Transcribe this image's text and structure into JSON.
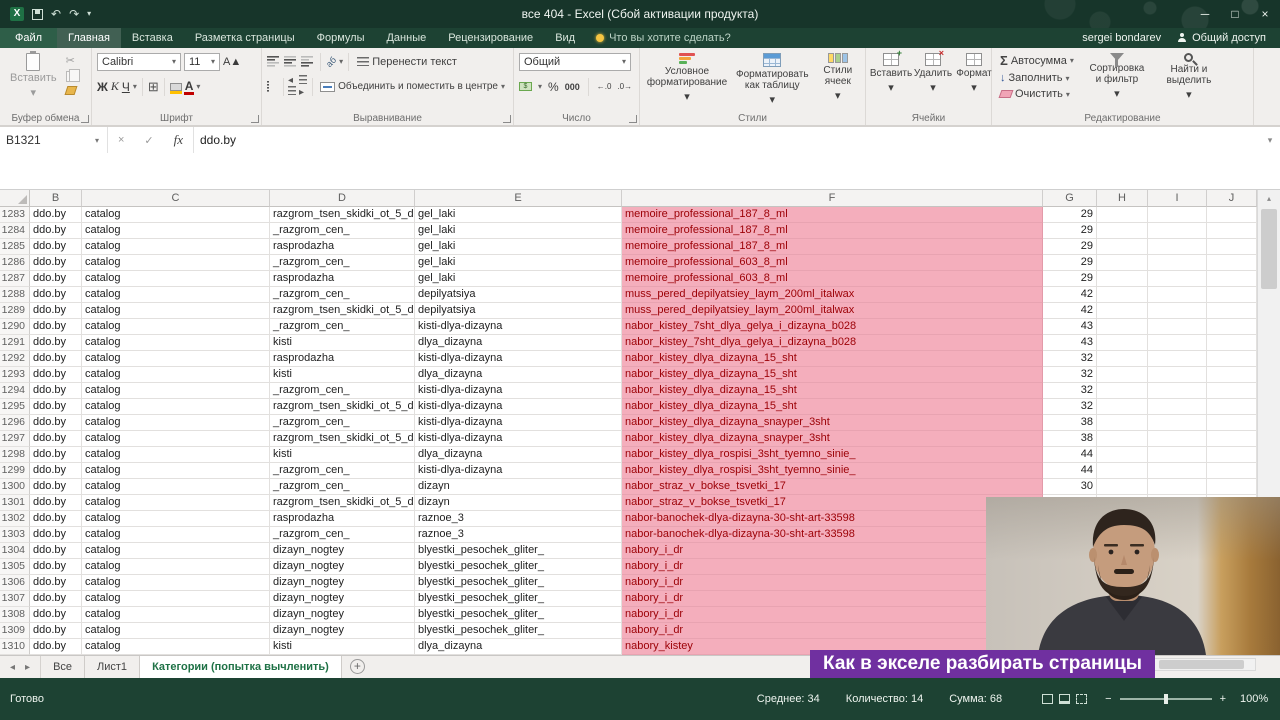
{
  "titlebar": {
    "title": "все 404  -  Excel (Сбой активации продукта)",
    "window_min": "─",
    "window_max": "□",
    "window_close": "×"
  },
  "account": {
    "user": "sergei bondarev",
    "share": "Общий доступ"
  },
  "ribbon_tabs": [
    {
      "label": "Файл",
      "type": "file"
    },
    {
      "label": "Главная",
      "active": true
    },
    {
      "label": "Вставка"
    },
    {
      "label": "Разметка страницы"
    },
    {
      "label": "Формулы"
    },
    {
      "label": "Данные"
    },
    {
      "label": "Рецензирование"
    },
    {
      "label": "Вид"
    }
  ],
  "tellme": "Что вы хотите сделать?",
  "ribbon": {
    "clipboard": {
      "paste": "Вставить",
      "label": "Буфер обмена"
    },
    "font": {
      "family": "Calibri",
      "size": "11",
      "bold": "Ж",
      "italic": "К",
      "underline": "Ч",
      "label": "Шрифт"
    },
    "alignment": {
      "wrap": "Перенести текст",
      "merge": "Объединить и поместить в центре",
      "label": "Выравнивание"
    },
    "number": {
      "format": "Общий",
      "thousands": "000",
      "percent": "%",
      "label": "Число"
    },
    "styles": {
      "conditional": "Условное форматирование",
      "table": "Форматировать как таблицу",
      "cellstyles": "Стили ячеек",
      "label": "Стили"
    },
    "cells": {
      "insert": "Вставить",
      "del": "Удалить",
      "format": "Формат",
      "label": "Ячейки"
    },
    "editing": {
      "autosum": "Автосумма",
      "fill": "Заполнить",
      "clear": "Очистить",
      "sort": "Сортировка и фильтр",
      "find": "Найти и выделить",
      "label": "Редактирование"
    }
  },
  "formula_bar": {
    "name_box": "B1321",
    "value": "ddo.by"
  },
  "icons": {
    "undo": "↶",
    "redo": "↷",
    "cancel": "×",
    "enter": "✓",
    "fx": "fx",
    "scissors": "✂",
    "borders": "⊞",
    "dropdown": "▾",
    "nav_left": "◂",
    "nav_right": "▸",
    "scroll_up": "▴",
    "scroll_down": "▾",
    "sigma": "Σ",
    "fill_down": "↓",
    "font_grow": "А▲",
    "font_shrink": "А▼",
    "add": "+",
    "zoom_minus": "−",
    "zoom_plus": "+"
  },
  "grid": {
    "columns": [
      "B",
      "C",
      "D",
      "E",
      "F",
      "G",
      "H",
      "I",
      "J"
    ],
    "rows": [
      {
        "n": "1283",
        "b": "ddo.by",
        "c": "catalog",
        "d": "razgrom_tsen_skidki_ot_5_d",
        "e": "gel_laki",
        "f": "memoire_professional_187_8_ml",
        "g": "29"
      },
      {
        "n": "1284",
        "b": "ddo.by",
        "c": "catalog",
        "d": "_razgrom_cen_",
        "e": "gel_laki",
        "f": "memoire_professional_187_8_ml",
        "g": "29"
      },
      {
        "n": "1285",
        "b": "ddo.by",
        "c": "catalog",
        "d": "rasprodazha",
        "e": "gel_laki",
        "f": "memoire_professional_187_8_ml",
        "g": "29"
      },
      {
        "n": "1286",
        "b": "ddo.by",
        "c": "catalog",
        "d": "_razgrom_cen_",
        "e": "gel_laki",
        "f": "memoire_professional_603_8_ml",
        "g": "29"
      },
      {
        "n": "1287",
        "b": "ddo.by",
        "c": "catalog",
        "d": "rasprodazha",
        "e": "gel_laki",
        "f": "memoire_professional_603_8_ml",
        "g": "29"
      },
      {
        "n": "1288",
        "b": "ddo.by",
        "c": "catalog",
        "d": "_razgrom_cen_",
        "e": "depilyatsiya",
        "f": "muss_pered_depilyatsiey_laym_200ml_italwax",
        "g": "42"
      },
      {
        "n": "1289",
        "b": "ddo.by",
        "c": "catalog",
        "d": "razgrom_tsen_skidki_ot_5_d",
        "e": "depilyatsiya",
        "f": "muss_pered_depilyatsiey_laym_200ml_italwax",
        "g": "42"
      },
      {
        "n": "1290",
        "b": "ddo.by",
        "c": "catalog",
        "d": "_razgrom_cen_",
        "e": "kisti-dlya-dizayna",
        "f": "nabor_kistey_7sht_dlya_gelya_i_dizayna_b028",
        "g": "43"
      },
      {
        "n": "1291",
        "b": "ddo.by",
        "c": "catalog",
        "d": "kisti",
        "e": "dlya_dizayna",
        "f": "nabor_kistey_7sht_dlya_gelya_i_dizayna_b028",
        "g": "43"
      },
      {
        "n": "1292",
        "b": "ddo.by",
        "c": "catalog",
        "d": "rasprodazha",
        "e": "kisti-dlya-dizayna",
        "f": "nabor_kistey_dlya_dizayna_15_sht",
        "g": "32"
      },
      {
        "n": "1293",
        "b": "ddo.by",
        "c": "catalog",
        "d": "kisti",
        "e": "dlya_dizayna",
        "f": "nabor_kistey_dlya_dizayna_15_sht",
        "g": "32"
      },
      {
        "n": "1294",
        "b": "ddo.by",
        "c": "catalog",
        "d": "_razgrom_cen_",
        "e": "kisti-dlya-dizayna",
        "f": "nabor_kistey_dlya_dizayna_15_sht",
        "g": "32"
      },
      {
        "n": "1295",
        "b": "ddo.by",
        "c": "catalog",
        "d": "razgrom_tsen_skidki_ot_5_d",
        "e": "kisti-dlya-dizayna",
        "f": "nabor_kistey_dlya_dizayna_15_sht",
        "g": "32"
      },
      {
        "n": "1296",
        "b": "ddo.by",
        "c": "catalog",
        "d": "_razgrom_cen_",
        "e": "kisti-dlya-dizayna",
        "f": "nabor_kistey_dlya_dizayna_snayper_3sht",
        "g": "38"
      },
      {
        "n": "1297",
        "b": "ddo.by",
        "c": "catalog",
        "d": "razgrom_tsen_skidki_ot_5_d",
        "e": "kisti-dlya-dizayna",
        "f": "nabor_kistey_dlya_dizayna_snayper_3sht",
        "g": "38"
      },
      {
        "n": "1298",
        "b": "ddo.by",
        "c": "catalog",
        "d": "kisti",
        "e": "dlya_dizayna",
        "f": "nabor_kistey_dlya_rospisi_3sht_tyemno_sinie_",
        "g": "44"
      },
      {
        "n": "1299",
        "b": "ddo.by",
        "c": "catalog",
        "d": "_razgrom_cen_",
        "e": "kisti-dlya-dizayna",
        "f": "nabor_kistey_dlya_rospisi_3sht_tyemno_sinie_",
        "g": "44"
      },
      {
        "n": "1300",
        "b": "ddo.by",
        "c": "catalog",
        "d": "_razgrom_cen_",
        "e": "dizayn",
        "f": "nabor_straz_v_bokse_tsvetki_17",
        "g": "30"
      },
      {
        "n": "1301",
        "b": "ddo.by",
        "c": "catalog",
        "d": "razgrom_tsen_skidki_ot_5_d",
        "e": "dizayn",
        "f": "nabor_straz_v_bokse_tsvetki_17",
        "g": ""
      },
      {
        "n": "1302",
        "b": "ddo.by",
        "c": "catalog",
        "d": "rasprodazha",
        "e": "raznoe_3",
        "f": "nabor-banochek-dlya-dizayna-30-sht-art-33598",
        "g": ""
      },
      {
        "n": "1303",
        "b": "ddo.by",
        "c": "catalog",
        "d": "_razgrom_cen_",
        "e": "raznoe_3",
        "f": "nabor-banochek-dlya-dizayna-30-sht-art-33598",
        "g": ""
      },
      {
        "n": "1304",
        "b": "ddo.by",
        "c": "catalog",
        "d": "dizayn_nogtey",
        "e": "blyestki_pesochek_gliter_",
        "f": "nabory_i_dr",
        "g": ""
      },
      {
        "n": "1305",
        "b": "ddo.by",
        "c": "catalog",
        "d": "dizayn_nogtey",
        "e": "blyestki_pesochek_gliter_",
        "f": "nabory_i_dr",
        "g": ""
      },
      {
        "n": "1306",
        "b": "ddo.by",
        "c": "catalog",
        "d": "dizayn_nogtey",
        "e": "blyestki_pesochek_gliter_",
        "f": "nabory_i_dr",
        "g": ""
      },
      {
        "n": "1307",
        "b": "ddo.by",
        "c": "catalog",
        "d": "dizayn_nogtey",
        "e": "blyestki_pesochek_gliter_",
        "f": "nabory_i_dr",
        "g": ""
      },
      {
        "n": "1308",
        "b": "ddo.by",
        "c": "catalog",
        "d": "dizayn_nogtey",
        "e": "blyestki_pesochek_gliter_",
        "f": "nabory_i_dr",
        "g": ""
      },
      {
        "n": "1309",
        "b": "ddo.by",
        "c": "catalog",
        "d": "dizayn_nogtey",
        "e": "blyestki_pesochek_gliter_",
        "f": "nabory_i_dr",
        "g": ""
      },
      {
        "n": "1310",
        "b": "ddo.by",
        "c": "catalog",
        "d": "kisti",
        "e": "dlya_dizayna",
        "f": "nabory_kistey",
        "g": ""
      }
    ]
  },
  "sheet_tabs": {
    "tabs": [
      {
        "label": "Все"
      },
      {
        "label": "Лист1"
      },
      {
        "label": "Категории (попытка вычленить)",
        "active": true
      }
    ]
  },
  "status_bar": {
    "ready": "Готово",
    "average": "Среднее: 34",
    "count": "Количество: 14",
    "sum": "Сумма: 68",
    "zoom": "100%"
  },
  "caption": {
    "text": "Как в экселе разбирать страницы"
  },
  "colors": {
    "title_green": "#17352a",
    "tab_green": "#1d4233",
    "accent_green": "#217346",
    "pink_fill": "#f4aebc",
    "pink_text": "#9c0006",
    "caption_purple": "#7030a0"
  }
}
